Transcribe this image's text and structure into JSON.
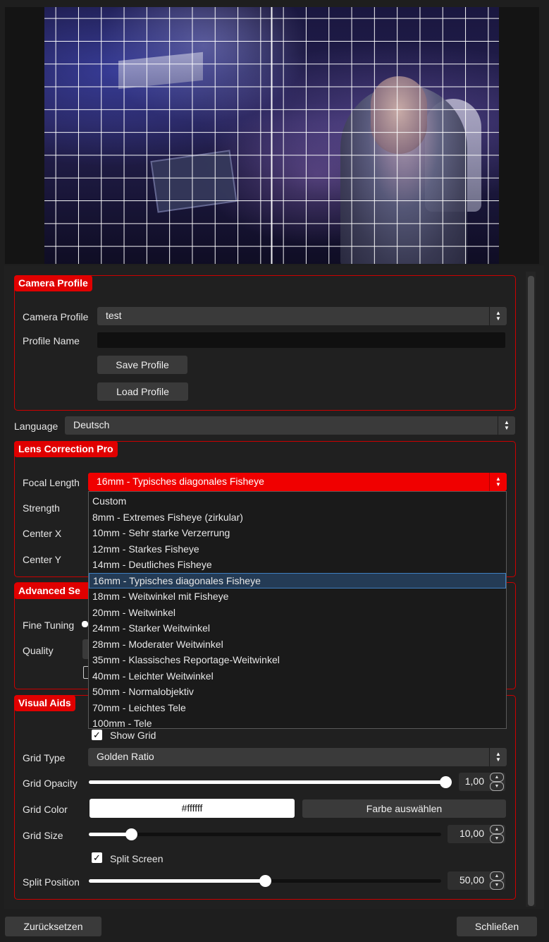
{
  "camera_profile": {
    "title": "Camera Profile",
    "profile_label": "Camera Profile",
    "profile_value": "test",
    "name_label": "Profile Name",
    "name_value": "",
    "save_label": "Save Profile",
    "load_label": "Load Profile"
  },
  "language": {
    "label": "Language",
    "value": "Deutsch"
  },
  "lens_correction": {
    "title": "Lens Correction Pro",
    "focal_label": "Focal Length",
    "focal_value": "16mm - Typisches diagonales Fisheye",
    "strength_label": "Strength",
    "center_x_label": "Center X",
    "center_y_label": "Center Y",
    "focal_options": [
      "Custom",
      "8mm - Extremes Fisheye (zirkular)",
      "10mm - Sehr starke Verzerrung",
      "12mm - Starkes Fisheye",
      "14mm - Deutliches Fisheye",
      "16mm - Typisches diagonales Fisheye",
      "18mm - Weitwinkel mit Fisheye",
      "20mm - Weitwinkel",
      "24mm - Starker Weitwinkel",
      "28mm - Moderater Weitwinkel",
      "35mm - Klassisches Reportage-Weitwinkel",
      "40mm - Leichter Weitwinkel",
      "50mm - Normalobjektiv",
      "70mm - Leichtes Tele",
      "100mm - Tele"
    ]
  },
  "advanced": {
    "title": "Advanced Se",
    "fine_tuning_label": "Fine Tuning",
    "quality_label": "Quality"
  },
  "visual_aids": {
    "title": "Visual Aids",
    "show_grid_label": "Show Grid",
    "show_grid_checked": true,
    "grid_type_label": "Grid Type",
    "grid_type_value": "Golden Ratio",
    "grid_opacity_label": "Grid Opacity",
    "grid_opacity_value": "1,00",
    "grid_opacity_fraction": 1.0,
    "grid_color_label": "Grid Color",
    "grid_color_value": "#ffffff",
    "choose_color_label": "Farbe auswählen",
    "grid_size_label": "Grid Size",
    "grid_size_value": "10,00",
    "grid_size_fraction": 0.108,
    "split_screen_label": "Split Screen",
    "split_screen_checked": true,
    "split_position_label": "Split Position",
    "split_position_value": "50,00",
    "split_position_fraction": 0.5
  },
  "footer": {
    "reset_label": "Zurücksetzen",
    "close_label": "Schließen"
  },
  "colors": {
    "accent": "#e00000",
    "background": "#1e1e1e",
    "control": "#3a3a3a"
  },
  "icons": {
    "spin": "updown-arrows-icon",
    "check": "checkmark-icon"
  }
}
